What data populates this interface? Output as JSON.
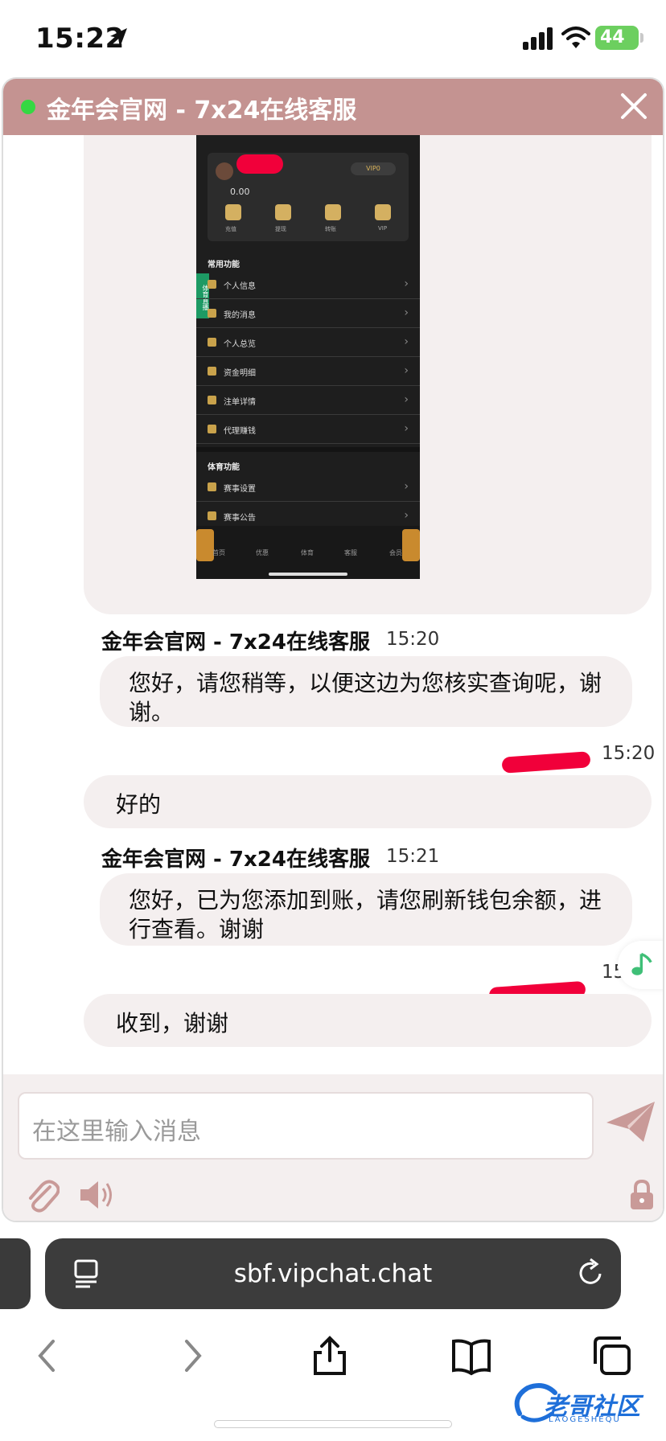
{
  "status_bar": {
    "time": "15:22",
    "battery": "44"
  },
  "chat": {
    "header_title": "金年会官网 - 7x24在线客服",
    "status_color": "#35d843",
    "header_color": "#c49391",
    "shared_image": {
      "card_balance": "0.00",
      "card_vip": "VIP0",
      "card_actions": [
        "充值",
        "提现",
        "转账",
        "VIP"
      ],
      "side_tag": "体育直播",
      "section1": "常用功能",
      "menu1": [
        "个人信息",
        "我的消息",
        "个人总览",
        "资金明细",
        "注单详情",
        "代理赚钱"
      ],
      "section2": "体育功能",
      "menu2": [
        "赛事设置",
        "赛事公告"
      ],
      "tabs": [
        "首页",
        "优惠",
        "体育",
        "客服",
        "会员"
      ]
    },
    "messages": [
      {
        "sender": "金年会官网 - 7x24在线客服",
        "time": "15:20",
        "text": "您好，请您稍等，以便这边为您核实查询呢，谢谢。"
      },
      {
        "sender": "user",
        "time": "15:20",
        "text": "好的"
      },
      {
        "sender": "金年会官网 - 7x24在线客服",
        "time": "15:21",
        "text": "您好，已为您添加到账，请您刷新钱包余额，进行查看。谢谢"
      },
      {
        "sender": "user",
        "time": "15:22",
        "text": "收到，谢谢"
      }
    ],
    "composer": {
      "placeholder": "在这里输入消息"
    }
  },
  "browser": {
    "url": "sbf.vipchat.chat"
  },
  "watermark": {
    "text": "老哥社区",
    "sub": "LAOGESHEQU"
  }
}
